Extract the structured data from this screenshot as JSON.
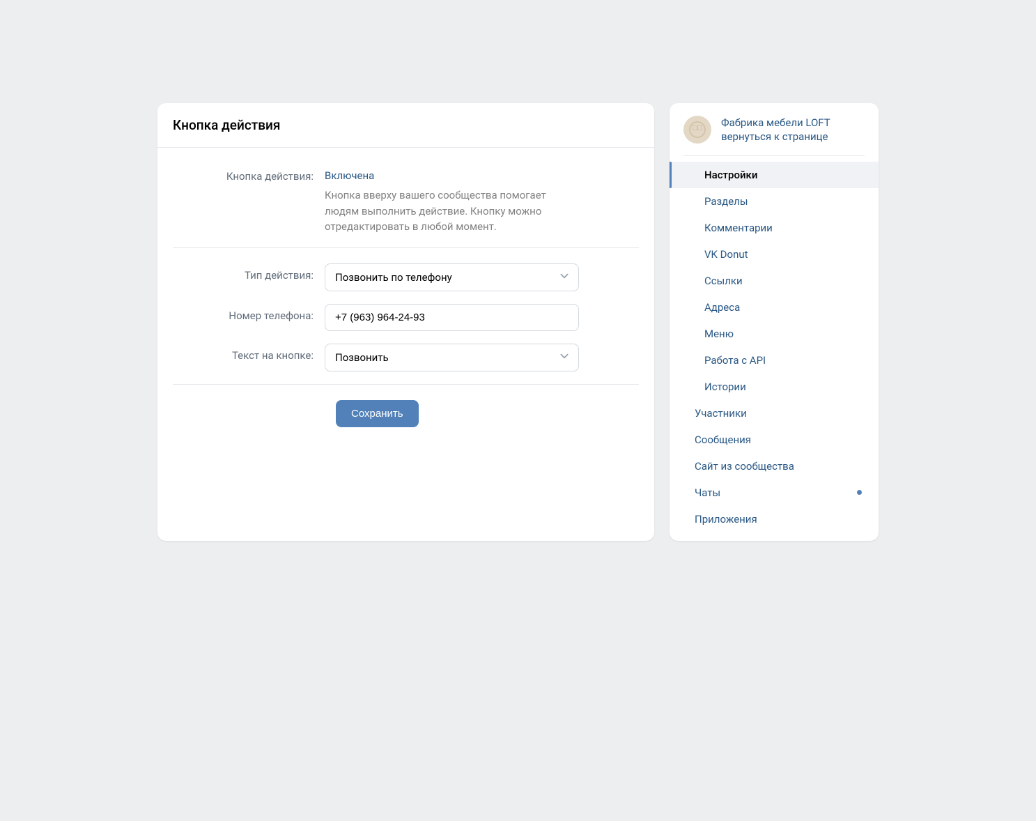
{
  "main": {
    "title": "Кнопка действия",
    "fields": {
      "status_label": "Кнопка действия:",
      "status_value": "Включена",
      "description": "Кнопка вверху вашего сообщества помогает людям выполнить действие. Кнопку можно отредактировать в любой момент.",
      "action_type_label": "Тип действия:",
      "action_type_value": "Позвонить по телефону",
      "phone_label": "Номер телефона:",
      "phone_value": "+7 (963) 964-24-93",
      "button_text_label": "Текст на кнопке:",
      "button_text_value": "Позвонить"
    },
    "save_label": "Сохранить"
  },
  "sidebar": {
    "community_name": "Фабрика мебели LOFT",
    "back_label": "вернуться к странице",
    "nav": {
      "settings": "Настройки",
      "sections": "Разделы",
      "comments": "Комментарии",
      "vkdonut": "VK Donut",
      "links": "Ссылки",
      "addresses": "Адреса",
      "menu": "Меню",
      "api": "Работа с API",
      "stories": "Истории",
      "members": "Участники",
      "messages": "Сообщения",
      "website": "Сайт из сообщества",
      "chats": "Чаты",
      "apps": "Приложения"
    }
  }
}
